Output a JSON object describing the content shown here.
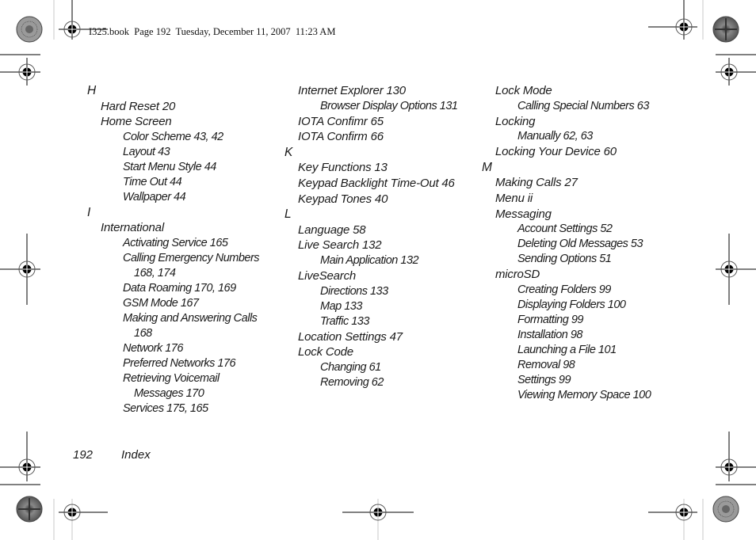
{
  "header": {
    "slug": "I325.book  Page 192  Tuesday, December 11, 2007  11:23 AM"
  },
  "columns": [
    {
      "entries": [
        {
          "level": 0,
          "text": "H"
        },
        {
          "level": 1,
          "text": "Hard Reset 20"
        },
        {
          "level": 1,
          "text": "Home Screen"
        },
        {
          "level": 2,
          "text": "Color Scheme 43, 42"
        },
        {
          "level": 2,
          "text": "Layout 43"
        },
        {
          "level": 2,
          "text": "Start Menu Style 44"
        },
        {
          "level": 2,
          "text": "Time Out 44"
        },
        {
          "level": 2,
          "text": "Wallpaper 44"
        },
        {
          "level": 0,
          "text": "I"
        },
        {
          "level": 1,
          "text": "International"
        },
        {
          "level": 2,
          "text": "Activating Service 165"
        },
        {
          "level": 2,
          "text": "Calling Emergency Numbers"
        },
        {
          "level": 3,
          "text": "168, 174"
        },
        {
          "level": 2,
          "text": "Data Roaming 170, 169"
        },
        {
          "level": 2,
          "text": "GSM Mode 167"
        },
        {
          "level": 2,
          "text": "Making and Answering Calls"
        },
        {
          "level": 3,
          "text": "168"
        },
        {
          "level": 2,
          "text": "Network 176"
        },
        {
          "level": 2,
          "text": "Preferred Networks 176"
        },
        {
          "level": 2,
          "text": "Retrieving Voicemail"
        },
        {
          "level": 3,
          "text": "Messages 170"
        },
        {
          "level": 2,
          "text": "Services 175, 165"
        }
      ]
    },
    {
      "entries": [
        {
          "level": 1,
          "text": "Internet Explorer 130"
        },
        {
          "level": 2,
          "text": "Browser Display Options 131"
        },
        {
          "level": 1,
          "text": "IOTA Confimr 65"
        },
        {
          "level": 1,
          "text": "IOTA Confirm 66"
        },
        {
          "level": 0,
          "text": "K"
        },
        {
          "level": 1,
          "text": "Key Functions 13"
        },
        {
          "level": 1,
          "text": "Keypad Backlight Time-Out 46"
        },
        {
          "level": 1,
          "text": "Keypad Tones 40"
        },
        {
          "level": 0,
          "text": "L"
        },
        {
          "level": 1,
          "text": "Language 58"
        },
        {
          "level": 1,
          "text": "Live Search 132"
        },
        {
          "level": 2,
          "text": "Main Application 132"
        },
        {
          "level": 1,
          "text": "LiveSearch"
        },
        {
          "level": 2,
          "text": "Directions 133"
        },
        {
          "level": 2,
          "text": "Map 133"
        },
        {
          "level": 2,
          "text": "Traffic 133"
        },
        {
          "level": 1,
          "text": "Location Settings 47"
        },
        {
          "level": 1,
          "text": "Lock Code"
        },
        {
          "level": 2,
          "text": "Changing 61"
        },
        {
          "level": 2,
          "text": "Removing 62"
        }
      ]
    },
    {
      "entries": [
        {
          "level": 1,
          "text": "Lock Mode"
        },
        {
          "level": 2,
          "text": "Calling Special Numbers 63"
        },
        {
          "level": 1,
          "text": "Locking"
        },
        {
          "level": 2,
          "text": "Manually 62, 63"
        },
        {
          "level": 1,
          "text": "Locking Your Device 60"
        },
        {
          "level": 0,
          "text": "M"
        },
        {
          "level": 1,
          "text": "Making Calls 27"
        },
        {
          "level": 1,
          "text": "Menu ii"
        },
        {
          "level": 1,
          "text": "Messaging"
        },
        {
          "level": 2,
          "text": "Account Settings 52"
        },
        {
          "level": 2,
          "text": "Deleting Old Messages 53"
        },
        {
          "level": 2,
          "text": "Sending Options 51"
        },
        {
          "level": 1,
          "text": "microSD"
        },
        {
          "level": 2,
          "text": "Creating Folders 99"
        },
        {
          "level": 2,
          "text": "Displaying Folders 100"
        },
        {
          "level": 2,
          "text": "Formatting 99"
        },
        {
          "level": 2,
          "text": "Installation 98"
        },
        {
          "level": 2,
          "text": "Launching a File 101"
        },
        {
          "level": 2,
          "text": "Removal 98"
        },
        {
          "level": 2,
          "text": "Settings 99"
        },
        {
          "level": 2,
          "text": "Viewing Memory Space 100"
        }
      ]
    }
  ],
  "footer": {
    "page_number": "192",
    "section": "Index"
  }
}
